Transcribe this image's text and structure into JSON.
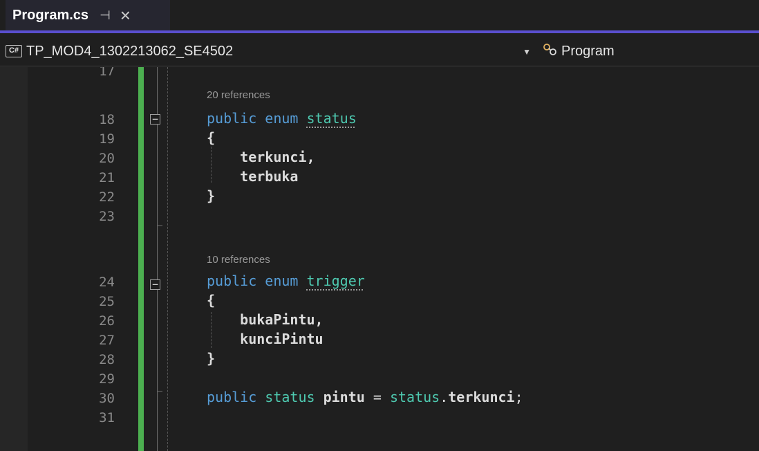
{
  "tab": {
    "file_name": "Program.cs",
    "pin_glyph": "⊣",
    "close_glyph": "×"
  },
  "navbar": {
    "project_badge": "C#",
    "project_name": "TP_MOD4_1302213062_SE4502",
    "dropdown_arrow": "▼",
    "type_name": "Program"
  },
  "editor": {
    "colors": {
      "keyword": "#569cd6",
      "type": "#4ec9b0",
      "text": "#dcdcdc",
      "line_number": "#8a8a8a",
      "change_bar": "#4caf50",
      "tab_underline": "#5a4fcf"
    },
    "line_numbers": [
      "17",
      "18",
      "19",
      "20",
      "21",
      "22",
      "23",
      "24",
      "25",
      "26",
      "27",
      "28",
      "29",
      "30",
      "31"
    ],
    "lens": {
      "status_refs": "20 references",
      "trigger_refs": "10 references"
    },
    "tokens": {
      "public": "public",
      "enum": "enum",
      "status": "status",
      "trigger": "trigger",
      "open_brace": "{",
      "close_brace": "}",
      "terkunci": "terkunci,",
      "terbuka": "terbuka",
      "bukaPintu": "bukaPintu,",
      "kunciPintu": "kunciPintu",
      "pintu": "pintu",
      "equals": "=",
      "dot": ".",
      "terkunci_member": "terkunci",
      "semicolon": ";"
    },
    "collapse_glyph": "−"
  }
}
